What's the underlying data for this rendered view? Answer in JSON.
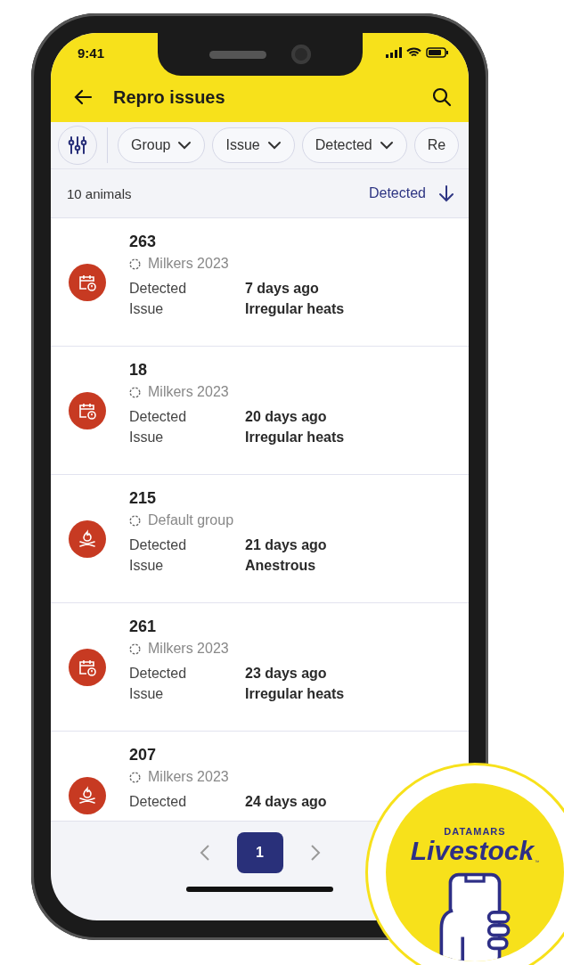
{
  "status_bar": {
    "time": "9:41"
  },
  "app_bar": {
    "title": "Repro issues"
  },
  "filters": [
    {
      "label": "Group",
      "dropdown": true
    },
    {
      "label": "Issue",
      "dropdown": true
    },
    {
      "label": "Detected",
      "dropdown": true
    },
    {
      "label": "Re",
      "dropdown": false
    }
  ],
  "list_header": {
    "count": "10 animals",
    "sort_label": "Detected"
  },
  "animals": [
    {
      "id": "263",
      "kind": "calendar",
      "group": "Milkers 2023",
      "fields": [
        {
          "label": "Detected",
          "value": "7 days ago"
        },
        {
          "label": "Issue",
          "value": "Irregular heats"
        }
      ]
    },
    {
      "id": "18",
      "kind": "calendar",
      "group": "Milkers 2023",
      "fields": [
        {
          "label": "Detected",
          "value": "20 days ago"
        },
        {
          "label": "Issue",
          "value": "Irregular heats"
        }
      ]
    },
    {
      "id": "215",
      "kind": "heat",
      "group": "Default group",
      "fields": [
        {
          "label": "Detected",
          "value": "21 days ago"
        },
        {
          "label": "Issue",
          "value": "Anestrous"
        }
      ]
    },
    {
      "id": "261",
      "kind": "calendar",
      "group": "Milkers 2023",
      "fields": [
        {
          "label": "Detected",
          "value": "23 days ago"
        },
        {
          "label": "Issue",
          "value": "Irregular heats"
        }
      ]
    },
    {
      "id": "207",
      "kind": "heat",
      "group": "Milkers 2023",
      "fields": [
        {
          "label": "Detected",
          "value": "24 days ago"
        }
      ]
    }
  ],
  "pagination": {
    "pages": [
      {
        "label": "1",
        "selected": true
      }
    ]
  },
  "badge": {
    "brand": "DATAMARS",
    "product": "Livestock",
    "mark": "™"
  }
}
